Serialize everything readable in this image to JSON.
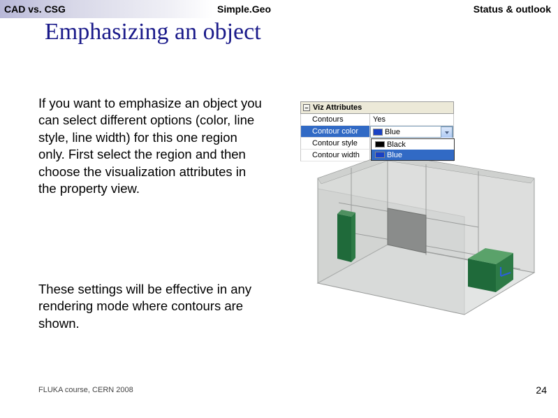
{
  "breadcrumb": {
    "left": "CAD vs. CSG",
    "middle": "Simple.Geo",
    "right": "Status & outlook"
  },
  "title": "Emphasizing an object",
  "body": {
    "p1": "If you want to emphasize an object you can select different options (color, line style, line width) for this one region only. First select the region and then choose the visualization attributes in the property view.",
    "p2": "These settings will be effective in any rendering mode where contours are shown."
  },
  "viz_panel": {
    "header": "Viz Attributes",
    "collapse_glyph": "–",
    "rows": [
      {
        "label": "Contours",
        "value": "Yes",
        "selected": false
      },
      {
        "label": "Contour color",
        "value": "Blue",
        "selected": true,
        "swatch": "#1941c4"
      },
      {
        "label": "Contour style",
        "value": "",
        "selected": false
      },
      {
        "label": "Contour width",
        "value": "",
        "selected": false
      }
    ],
    "dropdown": {
      "options": [
        {
          "label": "Black",
          "swatch": "#000000",
          "hover": false
        },
        {
          "label": "Blue",
          "swatch": "#1941c4",
          "hover": true
        }
      ]
    }
  },
  "scene": {
    "floor_fill": "#e3e5e4",
    "wall_fill": "#dddedd",
    "wall_shadow": "#c6c8c7",
    "dark_fill": "#8a8c8b",
    "cube_green_light": "#5aa26a",
    "cube_green_dark": "#1f6a3a",
    "grid_stroke": "#9a9c9b"
  },
  "footer": {
    "left": "FLUKA course, CERN 2008",
    "page": "24"
  }
}
